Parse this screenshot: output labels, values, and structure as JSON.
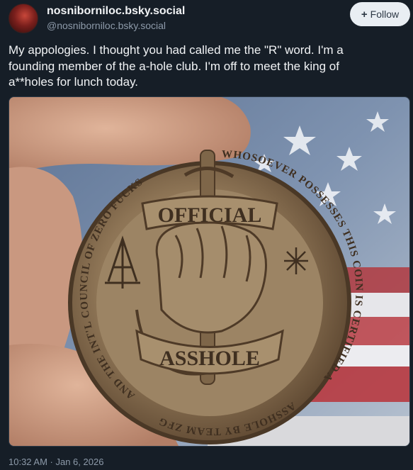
{
  "author": {
    "display_name": "nosniborniloc.bsky.social",
    "handle": "@nosniborniloc.bsky.social",
    "avatar": "avatar-image"
  },
  "follow_button": {
    "icon": "plus-icon",
    "label": "Follow"
  },
  "post": {
    "text_lines": [
      "My appologies.  I thought you had called me the \"R\" word.  I'm a",
      "founding member of the a-hole club.  I'm off to meet the king of",
      "a**holes for lunch today."
    ]
  },
  "coin": {
    "ribbon_top": "OFFICIAL",
    "ribbon_bottom": "ASSHOLE",
    "rim_left": "AND THE INT'L COUNCIL OF ZERO FUCKS",
    "rim_right": "WHOSOEVER POSSESSES THIS COIN IS CERTIFIED AN OFFICIAL",
    "rim_bottom": "ASSHOLE BY TEAM ZFG"
  },
  "timestamp": "10:32 AM · Jan 6, 2026"
}
